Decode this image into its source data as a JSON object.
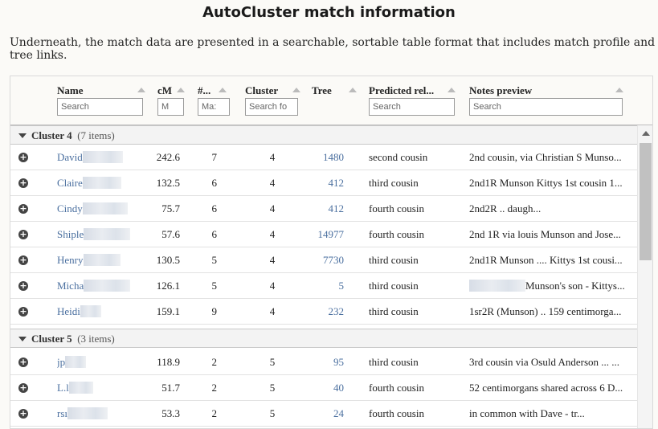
{
  "page": {
    "title": "AutoCluster match information",
    "intro": "Underneath, the match data are presented in a searchable, sortable table format that includes match profile and tree links."
  },
  "columns": [
    {
      "label": "Name",
      "placeholder": "Search"
    },
    {
      "label": "cM",
      "placeholder": "M"
    },
    {
      "label": "#...",
      "placeholder": "Ma:"
    },
    {
      "label": "Cluster",
      "placeholder": "Search fo"
    },
    {
      "label": "Tree",
      "placeholder": ""
    },
    {
      "label": "Predicted rel...",
      "placeholder": "Search"
    },
    {
      "label": "Notes preview",
      "placeholder": "Search"
    }
  ],
  "groups": [
    {
      "label": "Cluster 4",
      "count": "(7 items)",
      "rows": [
        {
          "name": "David",
          "cm": "242.6",
          "shared": "7",
          "cluster": "4",
          "tree": "1480",
          "rel": "second cousin",
          "notes": "2nd cousin, via Christian S Munso..."
        },
        {
          "name": "Claire",
          "cm": "132.5",
          "shared": "6",
          "cluster": "4",
          "tree": "412",
          "rel": "third cousin",
          "notes": "2nd1R Munson Kittys 1st cousin 1..."
        },
        {
          "name": "Cindy",
          "cm": "75.7",
          "shared": "6",
          "cluster": "4",
          "tree": "412",
          "rel": "fourth cousin",
          "notes": "2nd2R .. daugh..."
        },
        {
          "name": "Shiple",
          "cm": "57.6",
          "shared": "6",
          "cluster": "4",
          "tree": "14977",
          "rel": "fourth cousin",
          "notes": "2nd 1R via louis Munson and Jose..."
        },
        {
          "name": "Henry",
          "cm": "130.5",
          "shared": "5",
          "cluster": "4",
          "tree": "7730",
          "rel": "third cousin",
          "notes": "2nd1R Munson .... Kittys 1st cousi..."
        },
        {
          "name": "Micha",
          "cm": "126.1",
          "shared": "5",
          "cluster": "4",
          "tree": "5",
          "rel": "third cousin",
          "notes": "Munson's son - Kittys..."
        },
        {
          "name": "Heidi",
          "cm": "159.1",
          "shared": "9",
          "cluster": "4",
          "tree": "232",
          "rel": "third cousin",
          "notes": "1sr2R (Munson) .. 159 centimorga..."
        }
      ]
    },
    {
      "label": "Cluster 5",
      "count": "(3 items)",
      "rows": [
        {
          "name": "jp",
          "cm": "118.9",
          "shared": "2",
          "cluster": "5",
          "tree": "95",
          "rel": "third cousin",
          "notes": "3rd cousin via Osuld Anderson ... ..."
        },
        {
          "name": "L.l",
          "cm": "51.7",
          "shared": "2",
          "cluster": "5",
          "tree": "40",
          "rel": "fourth cousin",
          "notes": "52 centimorgans shared across 6 D..."
        },
        {
          "name": "rsı",
          "cm": "53.3",
          "shared": "2",
          "cluster": "5",
          "tree": "24",
          "rel": "fourth cousin",
          "notes": "in common with Dave - tr..."
        }
      ]
    }
  ],
  "icons": {
    "expand": "plus-circle-icon",
    "collapse": "caret-down-icon",
    "sort": "sort-asc-icon"
  },
  "colors": {
    "link": "#4a6f9f",
    "group_bg": "#f3f3f3"
  }
}
